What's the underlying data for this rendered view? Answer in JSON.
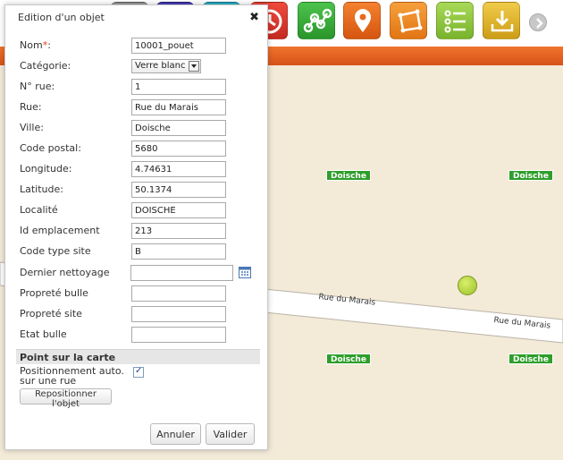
{
  "dialog": {
    "title": "Edition d'un objet",
    "close_glyph": "✖",
    "fields": {
      "nom": {
        "label": "Nom",
        "required_mark": "*",
        "label_suffix": ":",
        "value": "10001_pouet"
      },
      "categorie": {
        "label": "Catégorie:",
        "selected": "Verre blanc"
      },
      "no_rue": {
        "label": "N° rue:",
        "value": "1"
      },
      "rue": {
        "label": "Rue:",
        "value": "Rue du Marais"
      },
      "ville": {
        "label": "Ville:",
        "value": "Doische"
      },
      "code_postal": {
        "label": "Code postal:",
        "value": "5680"
      },
      "longitude": {
        "label": "Longitude:",
        "value": "4.74631"
      },
      "latitude": {
        "label": "Latitude:",
        "value": "50.1374"
      },
      "localite": {
        "label": "Localité",
        "value": "DOISCHE"
      },
      "id_emplacement": {
        "label": "Id emplacement",
        "value": "213"
      },
      "code_type_site": {
        "label": "Code type site",
        "value": "B"
      },
      "dernier_nettoyage": {
        "label": "Dernier nettoyage",
        "value": ""
      },
      "proprete_bulle": {
        "label": "Propreté bulle",
        "value": ""
      },
      "proprete_site": {
        "label": "Propreté site",
        "value": ""
      },
      "etat_bulle": {
        "label": "Etat bulle",
        "value": ""
      }
    },
    "section": {
      "title": "Point sur la carte",
      "auto_position_label": "Positionnement auto. sur une rue",
      "auto_position_checked": true,
      "reposition_button": "Repositionner l'objet"
    },
    "buttons": {
      "cancel": "Annuler",
      "validate": "Valider"
    }
  },
  "map": {
    "place_labels": [
      "Doische",
      "Doische",
      "Doische",
      "Doische"
    ],
    "road_labels": [
      "Rue du Marais",
      "Rue du Marais"
    ]
  },
  "toolbar": {
    "buttons": [
      {
        "icon": "clock-icon",
        "color": "#d9342b"
      },
      {
        "icon": "network-icon",
        "color": "#3aa73a"
      },
      {
        "icon": "map-pin-icon",
        "color": "#e86a1e"
      },
      {
        "icon": "polygon-icon",
        "color": "#f08a2a"
      },
      {
        "icon": "list-icon",
        "color": "#8cc63f"
      },
      {
        "icon": "download-icon",
        "color": "#e0b52a"
      }
    ],
    "next_icon": "chevron-right-icon"
  },
  "colors": {
    "accent_orange": "#e3601f",
    "place_label_green": "#2e9e2a",
    "map_background": "#f3ead8"
  }
}
